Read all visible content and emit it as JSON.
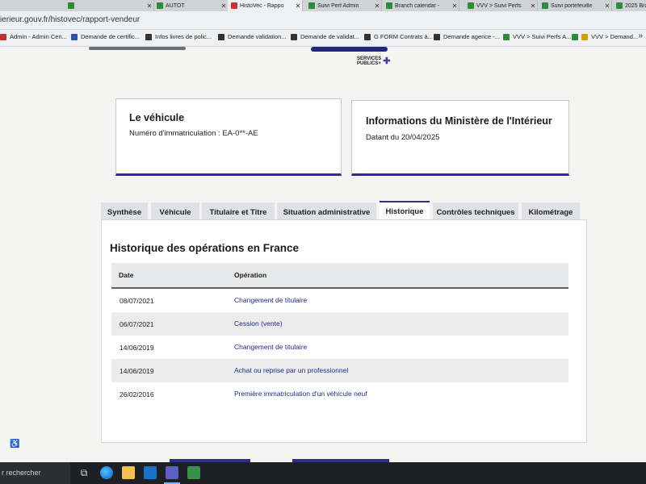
{
  "browser": {
    "tabs": [
      {
        "title": "",
        "color": "#2e8b3d"
      },
      {
        "title": "AUTOT",
        "color": "#2e8b3d"
      },
      {
        "title": "HistoVec - Rappo",
        "color": "#d03030",
        "active": true
      },
      {
        "title": "Suivi Perf Admin",
        "color": "#2e8b3d"
      },
      {
        "title": "Branch calendar -",
        "color": "#2e8b3d"
      },
      {
        "title": "VVV > Suivi Perfs",
        "color": "#2e8b3d"
      },
      {
        "title": "Suivi portefeuille",
        "color": "#2e8b3d"
      },
      {
        "title": "2025 Bra",
        "color": "#2e8b3d"
      }
    ],
    "url": "ierieur.gouv.fr/histovec/rapport-vendeur",
    "bookmarks": [
      {
        "label": "Admin - Admin Cen...",
        "color": "#b33"
      },
      {
        "label": "Demande de certific...",
        "color": "#3050b0"
      },
      {
        "label": "Infos livres de polic...",
        "color": "#333"
      },
      {
        "label": "Demande validation...",
        "color": "#333"
      },
      {
        "label": "Demande de validat...",
        "color": "#333"
      },
      {
        "label": "G FORM Contrats à...",
        "color": "#333"
      },
      {
        "label": "Demande agence -...",
        "color": "#333"
      },
      {
        "label": "VVV > Suivi Perfs A...",
        "color": "#2e8b3d"
      },
      {
        "label": "VVV > Demand...",
        "color": "#c9a300"
      }
    ],
    "more": "»"
  },
  "header": {
    "logo_line1": "SERVICES",
    "logo_line2": "PUBLICS+",
    "logo_plus": "✚"
  },
  "vehicle_card": {
    "title": "Le véhicule",
    "registration": "Numéro d'immatriculation : EA-0**-AE"
  },
  "ministry_card": {
    "title": "Informations du Ministère de l'Intérieur",
    "date": "Datant du 20/04/2025"
  },
  "tabs": [
    {
      "label": "Synthèse"
    },
    {
      "label": "Véhicule"
    },
    {
      "label": "Titulaire et Titre"
    },
    {
      "label": "Situation administrative"
    },
    {
      "label": "Historique",
      "active": true
    },
    {
      "label": "Contrôles techniques"
    },
    {
      "label": "Kilométrage"
    }
  ],
  "history": {
    "title": "Historique des opérations en France",
    "columns": [
      "Date",
      "Opération"
    ],
    "rows": [
      {
        "date": "08/07/2021",
        "operation": "Changement de titulaire"
      },
      {
        "date": "06/07/2021",
        "operation": "Cession (vente)"
      },
      {
        "date": "14/06/2019",
        "operation": "Changement de titulaire"
      },
      {
        "date": "14/06/2019",
        "operation": "Achat ou reprise par un professionnel"
      },
      {
        "date": "26/02/2016",
        "operation": "Première immatriculation d'un véhicule neuf"
      }
    ]
  },
  "taskbar": {
    "search_placeholder": "r rechercher",
    "apps": [
      "task-view-icon",
      "edge-icon",
      "file-explorer-icon",
      "outlook-icon",
      "teams-icon",
      "calculator-icon"
    ]
  },
  "colors": {
    "accent": "#2d2f8a",
    "link": "#1f2a8a"
  }
}
